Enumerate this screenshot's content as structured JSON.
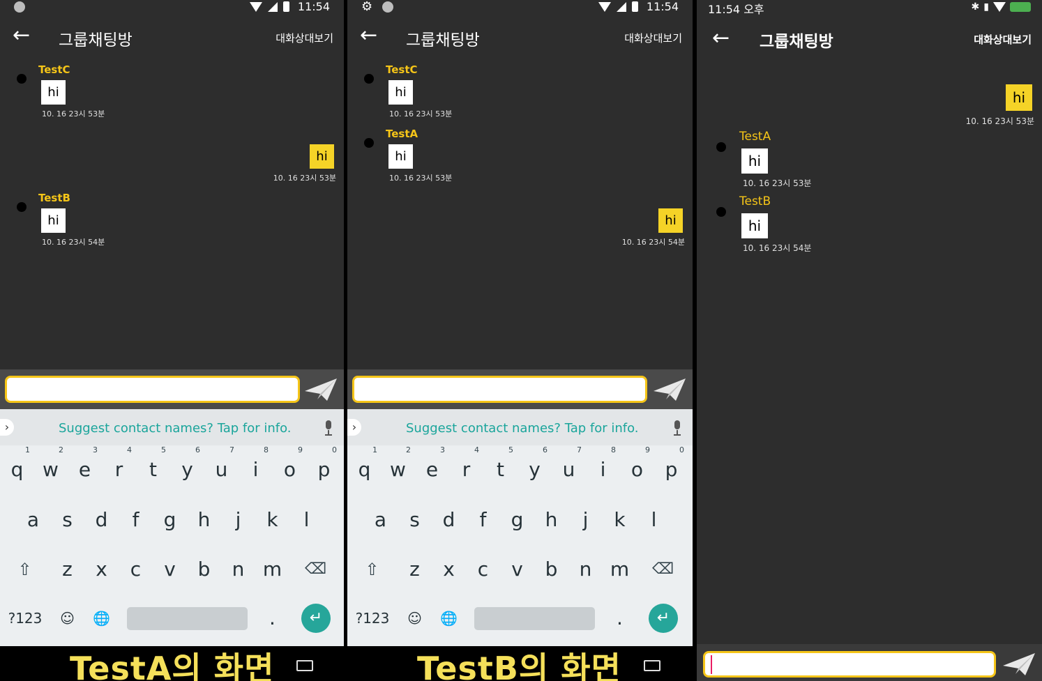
{
  "status": {
    "time": "11:54",
    "time_p3": "11:54 오후"
  },
  "appbar": {
    "title": "그룹채팅방",
    "view_partners": "대화상대보기"
  },
  "panel1": {
    "incoming": [
      {
        "sender": "TestC",
        "text": "hi",
        "time": "10. 16 23시 53분"
      },
      {
        "sender": "TestB",
        "text": "hi",
        "time": "10. 16 23시 54분"
      }
    ],
    "outgoing": [
      {
        "text": "hi",
        "time": "10. 16 23시 53분"
      }
    ],
    "caption": "TestA의 화면"
  },
  "panel2": {
    "incoming": [
      {
        "sender": "TestC",
        "text": "hi",
        "time": "10. 16 23시 53분"
      },
      {
        "sender": "TestA",
        "text": "hi",
        "time": "10. 16 23시 53분"
      }
    ],
    "outgoing": [
      {
        "text": "hi",
        "time": "10. 16 23시 54분"
      }
    ],
    "caption": "TestB의 화면"
  },
  "panel3": {
    "outgoing": [
      {
        "text": "hi",
        "time": "10. 16 23시 53분"
      }
    ],
    "incoming": [
      {
        "sender": "TestA",
        "text": "hi",
        "time": "10. 16 23시 53분"
      },
      {
        "sender": "TestB",
        "text": "hi",
        "time": "10. 16 23시 54분"
      }
    ]
  },
  "keyboard": {
    "suggestion": "Suggest contact names? Tap for info.",
    "row1": [
      "q",
      "w",
      "e",
      "r",
      "t",
      "y",
      "u",
      "i",
      "o",
      "p"
    ],
    "row1_hints": [
      "1",
      "2",
      "3",
      "4",
      "5",
      "6",
      "7",
      "8",
      "9",
      "0"
    ],
    "row2": [
      "a",
      "s",
      "d",
      "f",
      "g",
      "h",
      "j",
      "k",
      "l"
    ],
    "row3": [
      "z",
      "x",
      "c",
      "v",
      "b",
      "n",
      "m"
    ],
    "sym_label": "?123",
    "period": "."
  },
  "colors": {
    "accent": "#f5c518",
    "background": "#2d2d2d",
    "enter": "#26a69a",
    "suggest": "#1aa59b"
  }
}
